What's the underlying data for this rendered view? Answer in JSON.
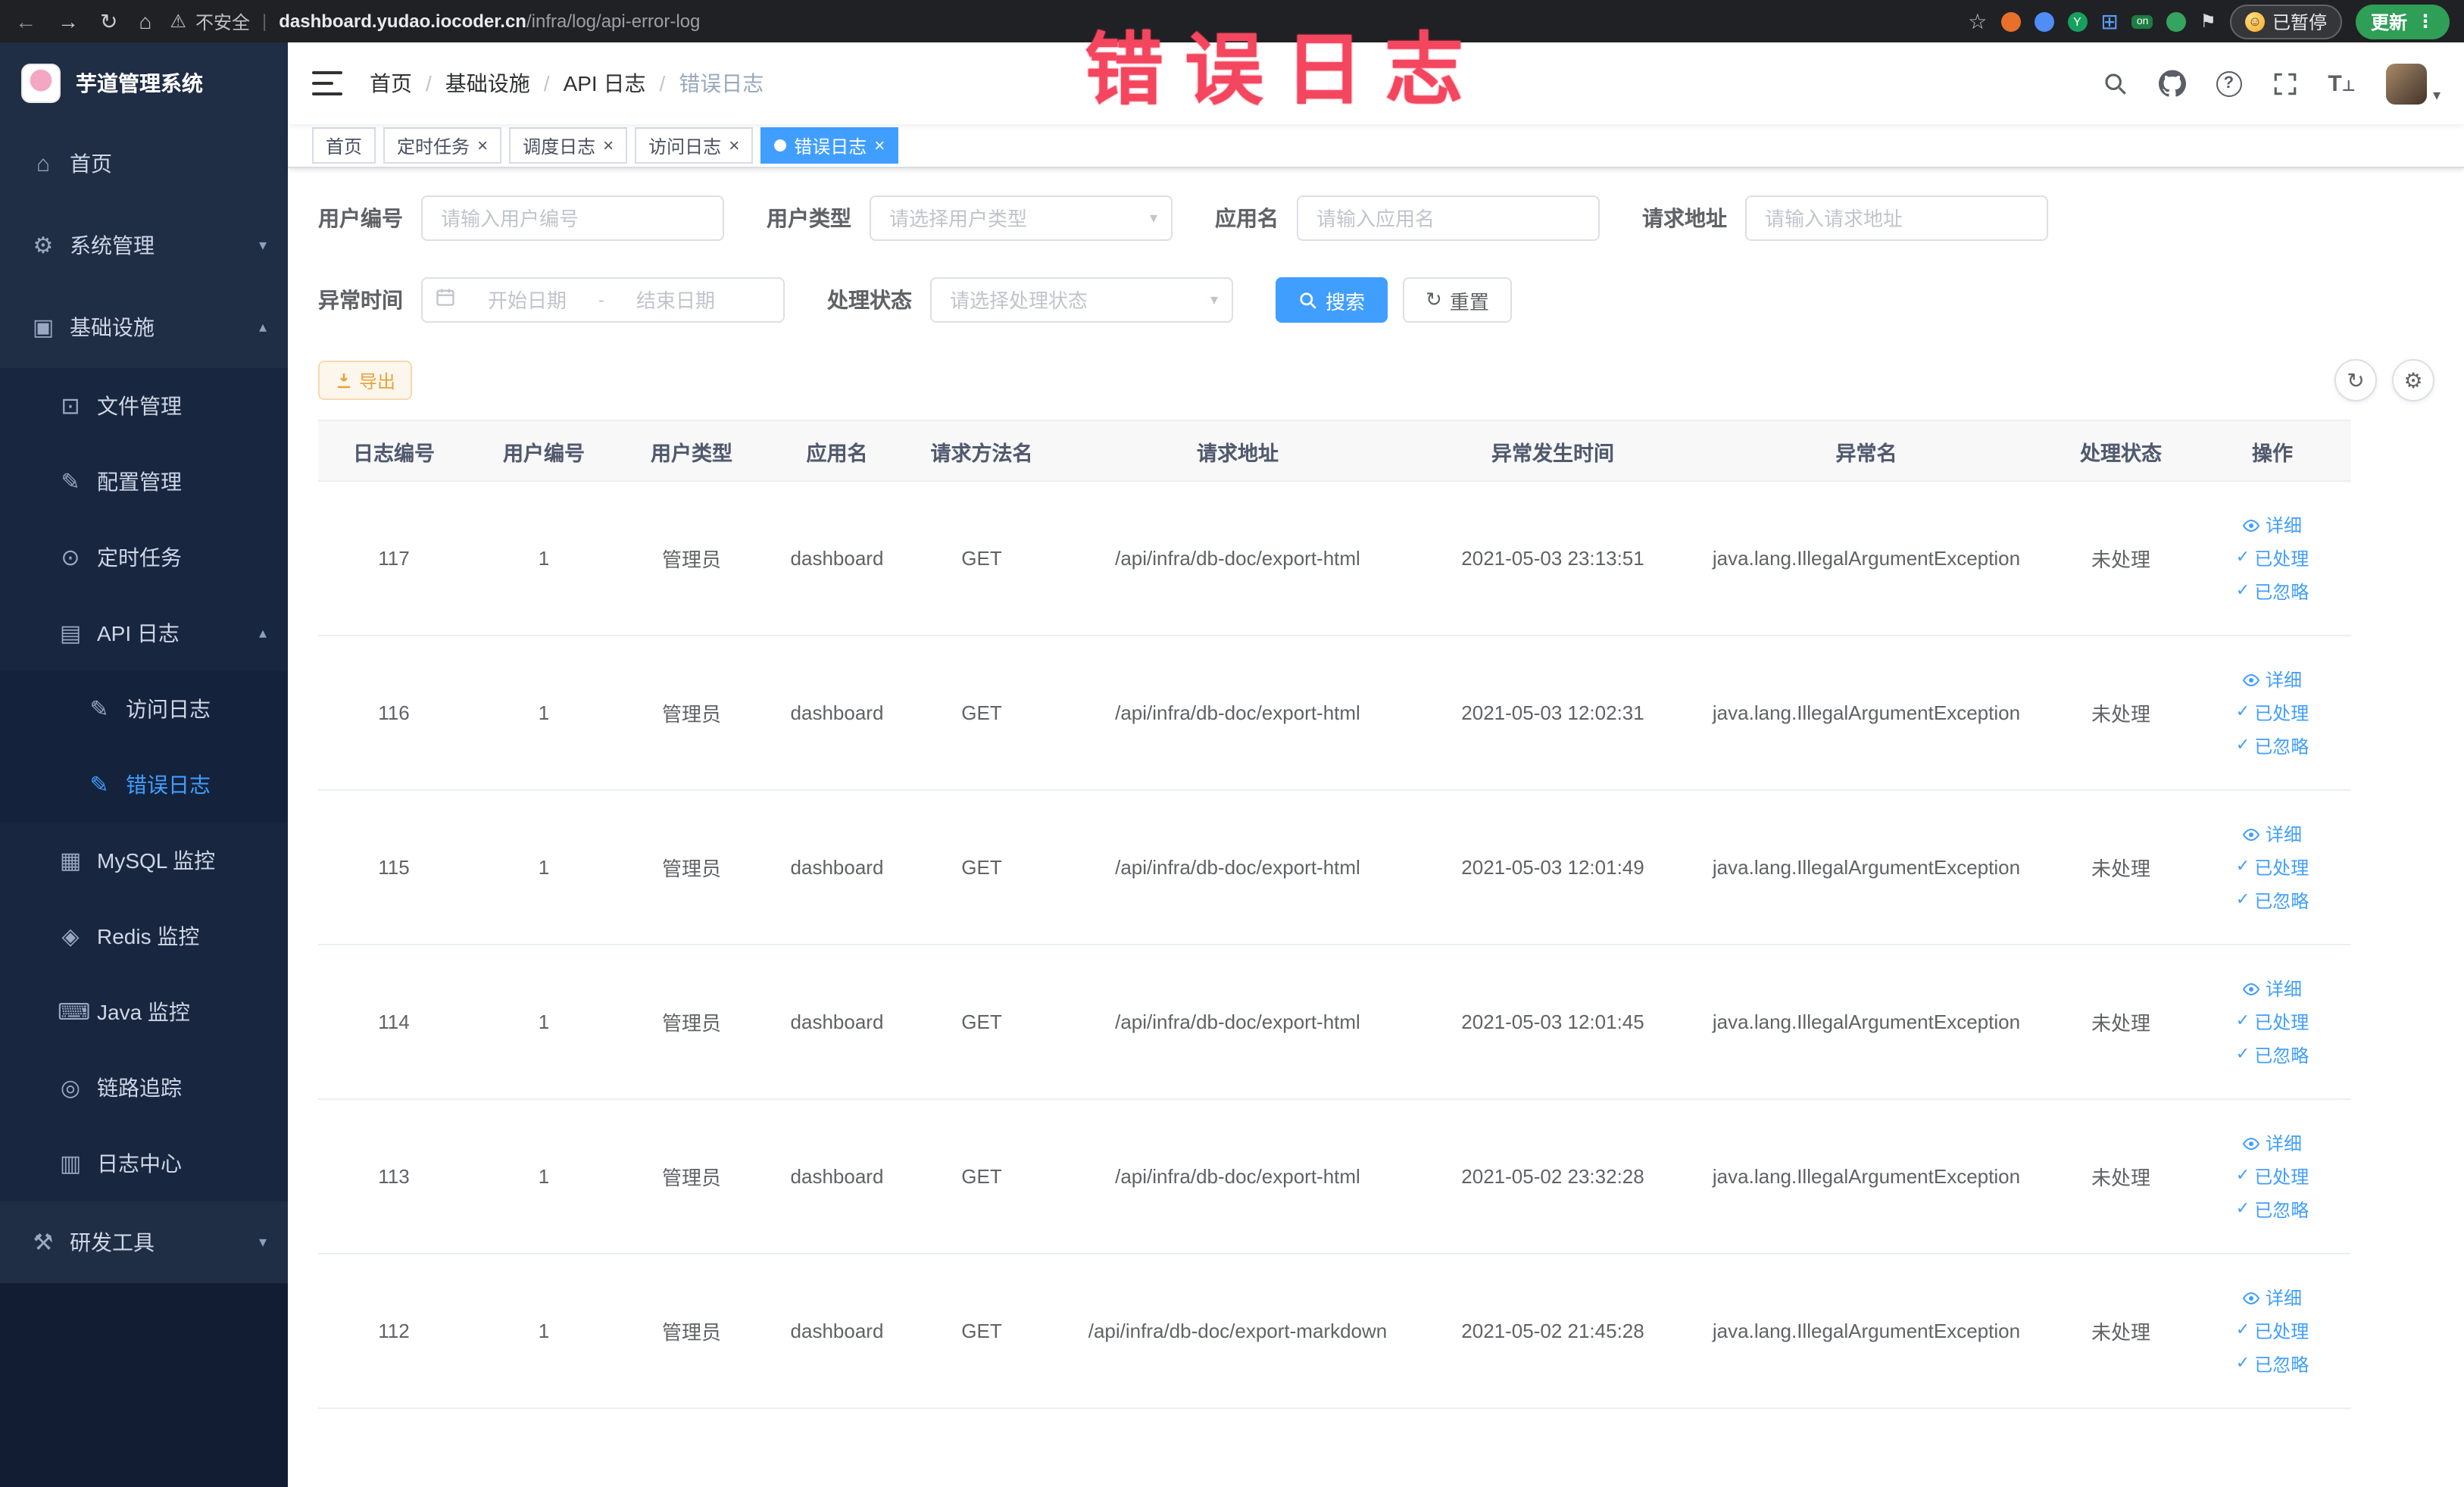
{
  "annotation": {
    "text": "错误日志"
  },
  "browser": {
    "security_label": "不安全",
    "url_domain": "dashboard.yudao.iocoder.cn",
    "url_path": "/infra/log/api-error-log",
    "ext_y_label": "Y",
    "ext_on_label": "on",
    "paused_label": "已暂停",
    "update_label": "更新"
  },
  "sidebar": {
    "title": "芋道管理系统",
    "menu": [
      {
        "label": "首页",
        "glyph": "⌂"
      },
      {
        "label": "系统管理",
        "glyph": "⚙",
        "arrow": "▾"
      },
      {
        "label": "基础设施",
        "glyph": "▣",
        "arrow": "▴"
      },
      {
        "label": "文件管理",
        "glyph": "⊡"
      },
      {
        "label": "配置管理",
        "glyph": "✎"
      },
      {
        "label": "定时任务",
        "glyph": "⊙"
      },
      {
        "label": "API 日志",
        "glyph": "▤",
        "arrow": "▴"
      },
      {
        "label": "访问日志",
        "glyph": "✎"
      },
      {
        "label": "错误日志",
        "glyph": "✎"
      },
      {
        "label": "MySQL 监控",
        "glyph": "▦"
      },
      {
        "label": "Redis 监控",
        "glyph": "◈"
      },
      {
        "label": "Java 监控",
        "glyph": "⌨"
      },
      {
        "label": "链路追踪",
        "glyph": "◎"
      },
      {
        "label": "日志中心",
        "glyph": "▥"
      },
      {
        "label": "研发工具",
        "glyph": "⚒",
        "arrow": "▾"
      }
    ]
  },
  "header": {
    "breadcrumb": [
      "首页",
      "基础设施",
      "API 日志",
      "错误日志"
    ]
  },
  "tabs": [
    {
      "label": "首页"
    },
    {
      "label": "定时任务"
    },
    {
      "label": "调度日志"
    },
    {
      "label": "访问日志"
    },
    {
      "label": "错误日志"
    }
  ],
  "filters": {
    "user_id": {
      "label": "用户编号",
      "placeholder": "请输入用户编号"
    },
    "user_type": {
      "label": "用户类型",
      "placeholder": "请选择用户类型"
    },
    "app_name": {
      "label": "应用名",
      "placeholder": "请输入应用名"
    },
    "request_url": {
      "label": "请求地址",
      "placeholder": "请输入请求地址"
    },
    "exception_time": {
      "label": "异常时间",
      "start_placeholder": "开始日期",
      "separator": "-",
      "end_placeholder": "结束日期"
    },
    "process_status": {
      "label": "处理状态",
      "placeholder": "请选择处理状态"
    },
    "search_button": "搜索",
    "reset_button": "重置"
  },
  "toolbar": {
    "export_label": "导出"
  },
  "table": {
    "columns": [
      "日志编号",
      "用户编号",
      "用户类型",
      "应用名",
      "请求方法名",
      "请求地址",
      "异常发生时间",
      "异常名",
      "处理状态",
      "操作"
    ],
    "actions": [
      "详细",
      "已处理",
      "已忽略"
    ],
    "rows": [
      {
        "cells": [
          "117",
          "1",
          "管理员",
          "dashboard",
          "GET",
          "/api/infra/db-doc/export-html",
          "2021-05-03 23:13:51",
          "java.lang.IllegalArgumentException",
          "未处理"
        ]
      },
      {
        "cells": [
          "116",
          "1",
          "管理员",
          "dashboard",
          "GET",
          "/api/infra/db-doc/export-html",
          "2021-05-03 12:02:31",
          "java.lang.IllegalArgumentException",
          "未处理"
        ]
      },
      {
        "cells": [
          "115",
          "1",
          "管理员",
          "dashboard",
          "GET",
          "/api/infra/db-doc/export-html",
          "2021-05-03 12:01:49",
          "java.lang.IllegalArgumentException",
          "未处理"
        ]
      },
      {
        "cells": [
          "114",
          "1",
          "管理员",
          "dashboard",
          "GET",
          "/api/infra/db-doc/export-html",
          "2021-05-03 12:01:45",
          "java.lang.IllegalArgumentException",
          "未处理"
        ]
      },
      {
        "cells": [
          "113",
          "1",
          "管理员",
          "dashboard",
          "GET",
          "/api/infra/db-doc/export-html",
          "2021-05-02 23:32:28",
          "java.lang.IllegalArgumentException",
          "未处理"
        ]
      },
      {
        "cells": [
          "112",
          "1",
          "管理员",
          "dashboard",
          "GET",
          "/api/infra/db-doc/export-markdown",
          "2021-05-02 21:45:28",
          "java.lang.IllegalArgumentException",
          "未处理"
        ]
      }
    ]
  }
}
